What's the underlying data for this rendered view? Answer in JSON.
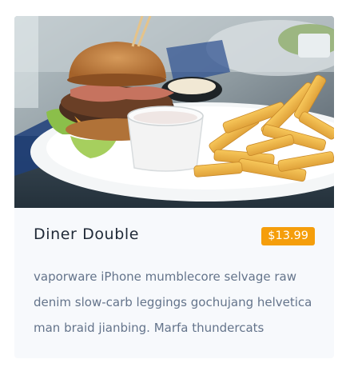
{
  "card": {
    "image_alt": "burger with fries",
    "title": "Diner Double",
    "price": "$13.99",
    "description": "vaporware iPhone mumblecore selvage raw denim slow-carb leggings gochujang helvetica man braid jianbing. Marfa thundercats"
  },
  "colors": {
    "card_bg": "#f7f9fc",
    "price_badge": "#f59e0b",
    "title_text": "#1f2937",
    "desc_text": "#64748b"
  }
}
